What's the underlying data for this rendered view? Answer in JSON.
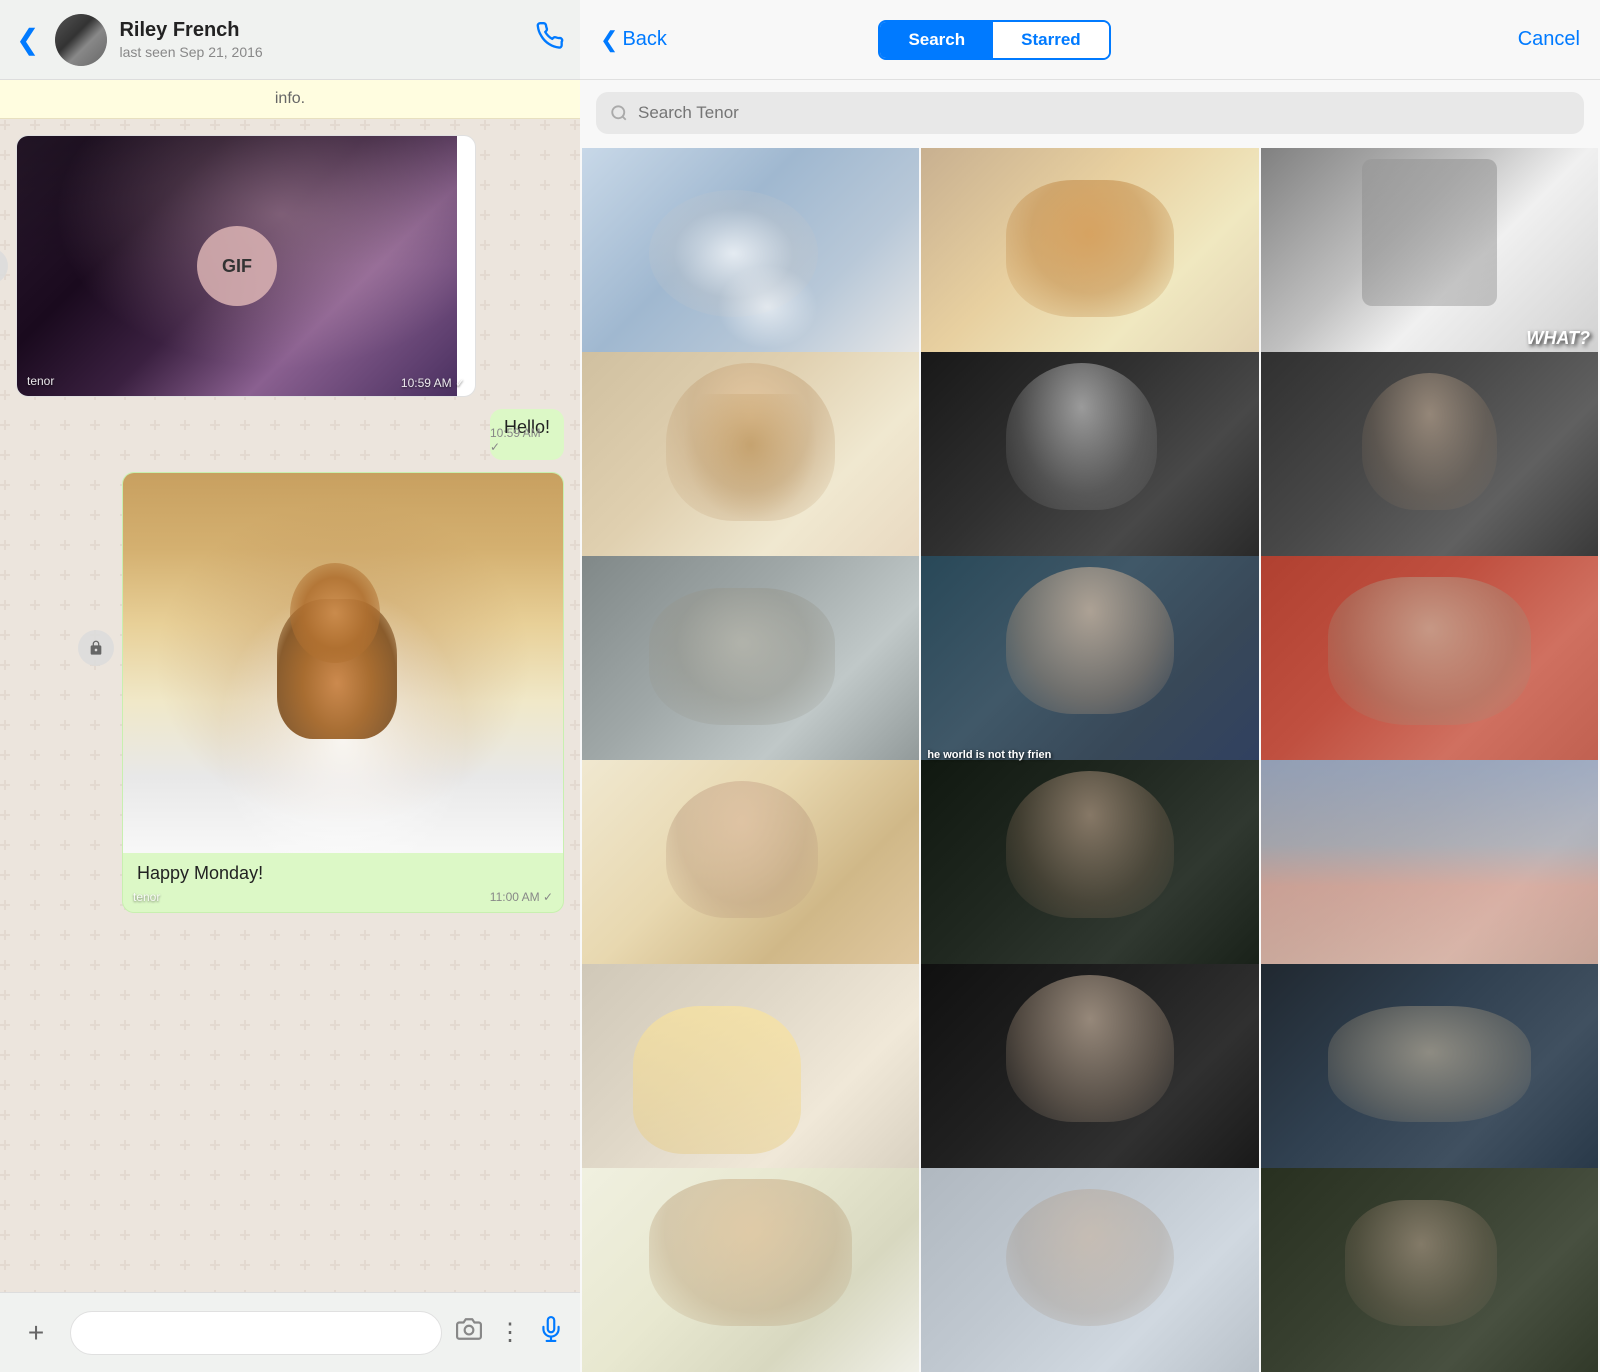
{
  "chat": {
    "back_label": "‹",
    "contact_name": "Riley French",
    "contact_status": "last seen Sep 21, 2016",
    "info_text": "info.",
    "gif1_label": "GIF",
    "gif1_tenor": "tenor",
    "gif1_time": "10:59 AM ✓",
    "hello_text": "Hello!",
    "hello_time": "10:59 AM ✓",
    "gif2_tenor": "tenor",
    "caption_text": "Happy Monday!",
    "caption_time": "11:00 AM ✓",
    "input_placeholder": ""
  },
  "gif_picker": {
    "back_label": "Back",
    "search_tab": "Search",
    "starred_tab": "Starred",
    "cancel_label": "Cancel",
    "search_placeholder": "Search Tenor",
    "cells": [
      {
        "id": 1,
        "class": "gc-1",
        "overlay": ""
      },
      {
        "id": 2,
        "class": "gc-2",
        "overlay": ""
      },
      {
        "id": 3,
        "class": "gc-3",
        "overlay": "WHAT?"
      },
      {
        "id": 4,
        "class": "gc-4",
        "overlay": ""
      },
      {
        "id": 5,
        "class": "gc-5",
        "overlay": ""
      },
      {
        "id": 6,
        "class": "gc-6",
        "overlay": ""
      },
      {
        "id": 7,
        "class": "gc-7",
        "overlay": ""
      },
      {
        "id": 8,
        "class": "gc-8",
        "caption": "he world is not thy frien"
      },
      {
        "id": 9,
        "class": "gc-9",
        "overlay": ""
      },
      {
        "id": 10,
        "class": "gc-10",
        "overlay": ""
      },
      {
        "id": 11,
        "class": "gc-11",
        "overlay": ""
      },
      {
        "id": 12,
        "class": "gc-12",
        "overlay": ""
      },
      {
        "id": 13,
        "class": "gc-13",
        "overlay": ""
      },
      {
        "id": 14,
        "class": "gc-14",
        "overlay": ""
      },
      {
        "id": 15,
        "class": "gc-15",
        "overlay": ""
      },
      {
        "id": 16,
        "class": "gc-16",
        "overlay": ""
      },
      {
        "id": 17,
        "class": "gc-17",
        "overlay": ""
      },
      {
        "id": 18,
        "class": "gc-18",
        "overlay": ""
      }
    ]
  },
  "icons": {
    "back_chevron": "❮",
    "phone": "✆",
    "search": "🔍",
    "plus": "+",
    "camera": "⊙",
    "dots": "⋮",
    "mic": "♪",
    "share": "↩"
  },
  "colors": {
    "blue": "#007aff",
    "chat_bg": "#ece5dd",
    "sent_bubble": "#dcf8c6",
    "received_bubble": "#ffffff",
    "header_bg": "#f0f2f0",
    "gif_panel_bg": "#f8f8f8",
    "search_bar_bg": "#e8e8e8",
    "seg_active": "#007aff",
    "seg_inactive": "#ffffff"
  }
}
